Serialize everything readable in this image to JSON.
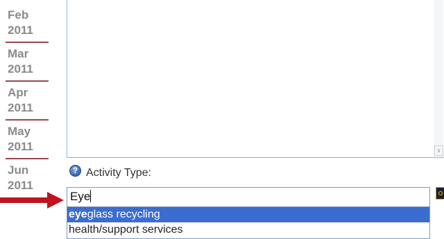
{
  "months": [
    {
      "month": "Feb",
      "year": "2011"
    },
    {
      "month": "Mar",
      "year": "2011"
    },
    {
      "month": "Apr",
      "year": "2011"
    },
    {
      "month": "May",
      "year": "2011"
    },
    {
      "month": "Jun",
      "year": "2011"
    }
  ],
  "form": {
    "help_icon_glyph": "?",
    "activity_label": "Activity Type:",
    "input_value": "Eye",
    "suggestions": [
      {
        "match": "eye",
        "rest": "glass recycling",
        "selected": true
      },
      {
        "match": "",
        "rest": "health/support services",
        "selected": false
      }
    ]
  },
  "colors": {
    "month_divider": "#9a4750",
    "selected_suggestion": "#3b6ccf",
    "arrow": "#c0141e"
  },
  "icons": {
    "help": "question-circle-icon",
    "arrow": "right-arrow-icon",
    "side": "search-icon"
  }
}
